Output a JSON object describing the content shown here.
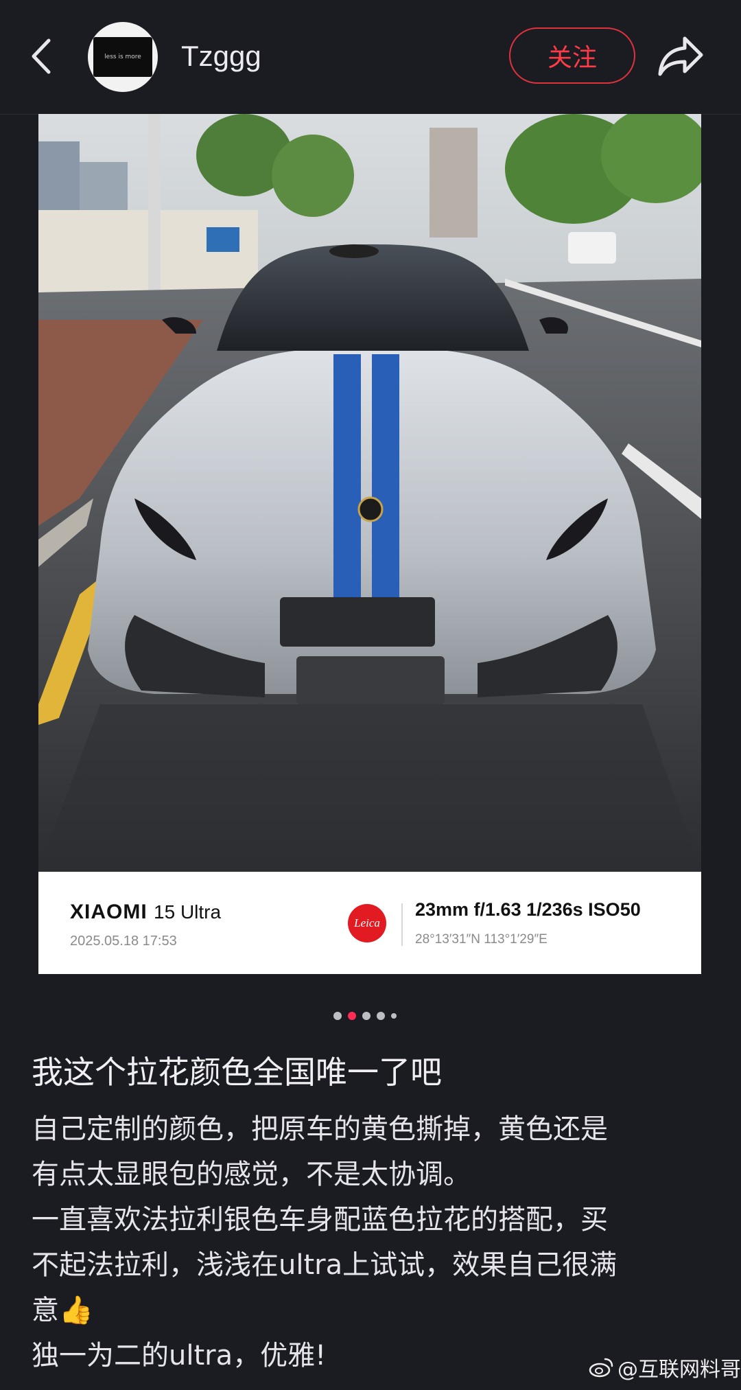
{
  "header": {
    "back_icon": "chevron-left-icon",
    "avatar_text": "less is more",
    "username": "Tzggg",
    "follow_label": "关注",
    "share_icon": "share-arrow-icon",
    "accent_color": "#ff3b47"
  },
  "photo": {
    "subject": "car-photo",
    "watermark": {
      "brand": "XIAOMI",
      "model": "15 Ultra",
      "datetime": "2025.05.18   17:53",
      "leica_logo_text": "Leica",
      "exif": "23mm  f/1.63  1/236s  ISO50",
      "gps": "28°13′31″N  113°1′29″E"
    }
  },
  "carousel": {
    "total": 5,
    "active_index": 1
  },
  "post": {
    "title": "我这个拉花颜色全国唯一了吧",
    "lines": [
      "自己定制的颜色，把原车的黄色撕掉，黄色还是",
      "有点太显眼包的感觉，不是太协调。",
      "一直喜欢法拉利银色车身配蓝色拉花的搭配，买",
      "不起法拉利，浅浅在ultra上试试，效果自己很满",
      "意👍",
      "独一为二的ultra，优雅!"
    ]
  },
  "credit": {
    "icon": "weibo-icon",
    "text": "@互联网料哥"
  }
}
